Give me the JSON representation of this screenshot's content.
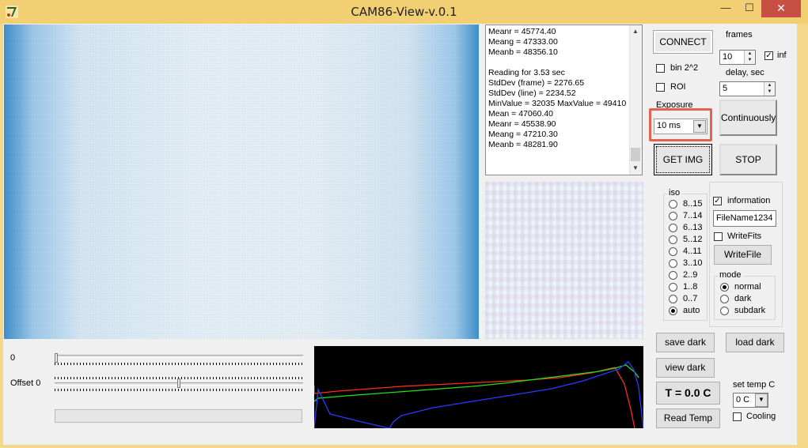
{
  "window": {
    "title": "CAM86-View-v.0.1",
    "minimize_glyph": "—",
    "maximize_glyph": "☐",
    "close_glyph": "✕",
    "icon": "app-icon"
  },
  "log": {
    "text": "Meanr = 45774.40\nMeang = 47333.00\nMeanb = 48356.10\n\nReading for 3.53 sec\nStdDev (frame) = 2276.65\nStdDev (line) = 2234.52\nMinValue = 32035 MaxValue = 49410\nMean = 47060.40\nMeanr = 45538.90\nMeang = 47210.30\nMeanb = 48281.90",
    "scroll_up": "▲",
    "scroll_down": "▼"
  },
  "sliders": {
    "gain_label": "0",
    "gain_value": 0.0,
    "offset_label": "Offset 0",
    "offset_value": 0.5,
    "progress": 0
  },
  "controls": {
    "connect": "CONNECT",
    "frames_label": "frames",
    "frames_value": "10",
    "inf_label": "inf",
    "inf_checked": true,
    "bin_label": "bin 2^2",
    "bin_checked": false,
    "roi_label": "ROI",
    "roi_checked": false,
    "delay_label": "delay, sec",
    "delay_value": "5",
    "exposure_label": "Exposure",
    "exposure_value": "10 ms",
    "continuously": "Continuously",
    "get_img": "GET IMG",
    "stop": "STOP",
    "spin_up": "▲",
    "spin_down": "▼",
    "dropdown": "▼",
    "check_mark": "✓"
  },
  "iso": {
    "legend": "iso",
    "options": [
      "8..15",
      "7..14",
      "6..13",
      "5..12",
      "4..11",
      "3..10",
      "2..9",
      "1..8",
      "0..7",
      "auto"
    ],
    "selected": "auto"
  },
  "output": {
    "information_label": "information",
    "information_checked": true,
    "filename": "FileName1234",
    "writefits_label": "WriteFits",
    "writefits_checked": false,
    "writefile": "WriteFile"
  },
  "mode": {
    "legend": "mode",
    "options": [
      "normal",
      "dark",
      "subdark"
    ],
    "selected": "normal"
  },
  "dark": {
    "save": "save dark",
    "load": "load dark",
    "view": "view dark"
  },
  "temperature": {
    "display": "T = 0.0 C",
    "read": "Read Temp",
    "set_label": "set temp C",
    "set_value": "0 C",
    "cooling_label": "Cooling",
    "cooling_checked": false
  },
  "histogram_colors": {
    "red": "#ff2a1a",
    "green": "#22e01e",
    "blue": "#2a3aff"
  }
}
